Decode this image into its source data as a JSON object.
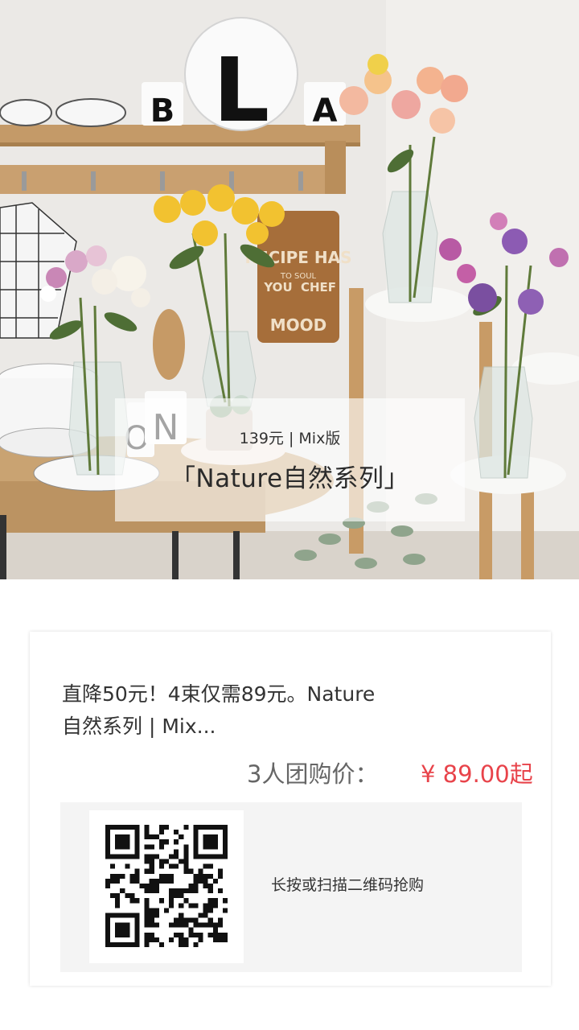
{
  "hero": {
    "shelf_letters": [
      "B",
      "L",
      "A"
    ],
    "mug_letters": [
      "O",
      "N"
    ],
    "board_text": [
      "RECIPE HAS",
      "TO SOUL",
      "YOU ",
      "CHEF",
      "MOOD"
    ],
    "overlay": {
      "price_line": "139元 | Mix版",
      "series_title": "「Nature自然系列」"
    }
  },
  "card": {
    "title_line1": "直降50元！4束仅需89元。Nature",
    "title_line2": "自然系列 | Mix...",
    "group_label": "3人团购价：",
    "price": "¥ 89.00起",
    "qr_hint": "长按或扫描二维码抢购"
  },
  "colors": {
    "accent_price": "#e8434a",
    "panel_bg": "#f4f4f4"
  },
  "icons": [
    "qr-code-icon"
  ]
}
